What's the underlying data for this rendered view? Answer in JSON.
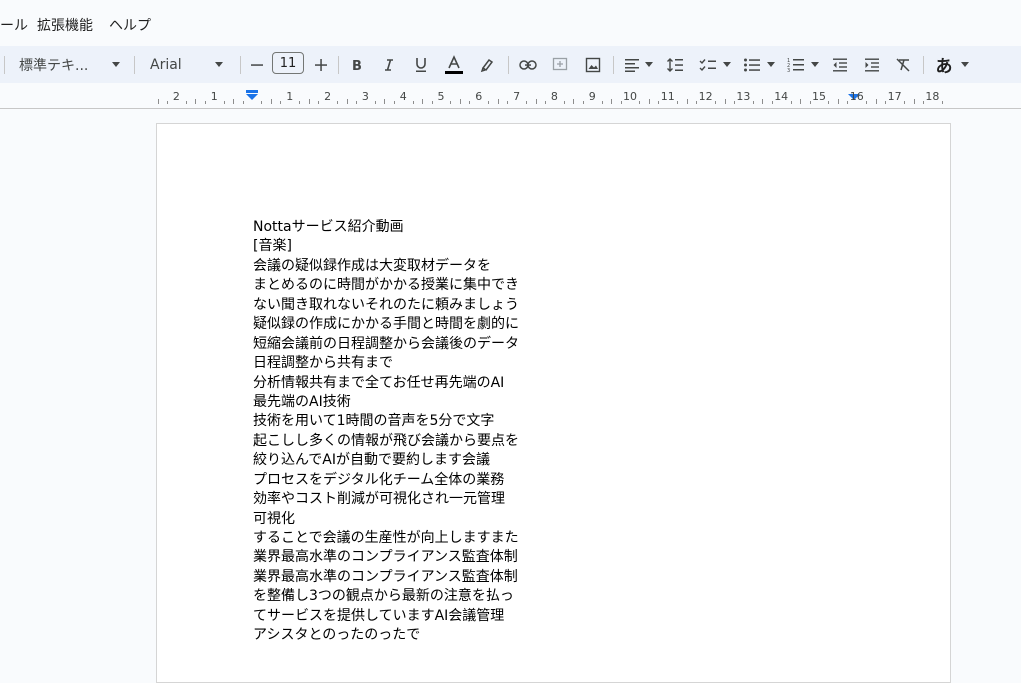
{
  "menu": {
    "items": [
      {
        "label": "ール"
      },
      {
        "label": "拡張機能"
      },
      {
        "label": "ヘルプ"
      }
    ]
  },
  "toolbar": {
    "style_label": "標準テキ...",
    "font_label": "Arial",
    "font_size": "11",
    "ime_label": "あ",
    "text_color": "#000000"
  },
  "ruler": {
    "labels": [
      "2",
      "1",
      "1",
      "2",
      "3",
      "4",
      "5",
      "6",
      "7",
      "8",
      "9",
      "10",
      "11",
      "12",
      "13",
      "14",
      "15",
      "16",
      "17",
      "18"
    ]
  },
  "document": {
    "lines": [
      "Nottaサービス紹介動画",
      "[音楽]",
      "会議の疑似録作成は大変取材データを",
      "まとめるのに時間がかかる授業に集中でき",
      "ない聞き取れないそれのたに頼みましょう",
      "疑似録の作成にかかる手間と時間を劇的に",
      "短縮会議前の日程調整から会議後のデータ",
      "日程調整から共有まで",
      "分析情報共有まで全てお任せ再先端のAI",
      "最先端のAI技術",
      "技術を用いて1時間の音声を5分で文字",
      "起こしし多くの情報が飛び会議から要点を",
      "絞り込んでAIが自動で要約します会議",
      "プロセスをデジタル化チーム全体の業務",
      "効率やコスト削減が可視化され一元管理",
      "可視化",
      "することで会議の生産性が向上しますまた",
      "業界最高水準のコンプライアンス監査体制",
      "業界最高水準のコンプライアンス監査体制",
      "を整備し3つの観点から最新の注意を払っ",
      "てサービスを提供していますAI会議管理",
      "アシスタとのったのったで"
    ]
  },
  "colors": {
    "toolbar_bg": "#edf2fa",
    "page_bg": "#ffffff",
    "canvas_bg": "#f9fbfd",
    "ruler_marker": "#1a73e8"
  }
}
